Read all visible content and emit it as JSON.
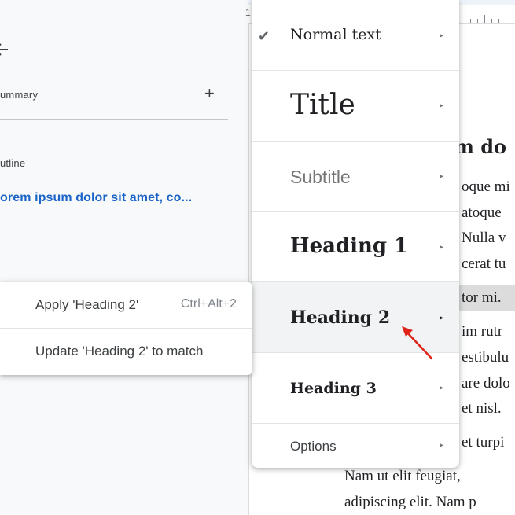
{
  "ruler": {
    "number": "1"
  },
  "outline_panel": {
    "summary_label": "ummary",
    "add_icon": "+",
    "outline_label": "utline",
    "outline_item": "orem ipsum dolor sit amet, co..."
  },
  "document": {
    "heading": "um do",
    "lines": [
      "oque mi",
      "atoque",
      "Nulla v",
      "cerat tu",
      "tor mi.",
      "im rutr",
      "estibulu",
      "are dolo",
      "et nisl.",
      "et turpi",
      "Nam ut elit feugiat,",
      "adipiscing elit. Nam p"
    ]
  },
  "styles_menu": {
    "check_icon": "✔",
    "chevron_icon": "▸",
    "items": [
      {
        "label": "Normal text"
      },
      {
        "label": "Title"
      },
      {
        "label": "Subtitle"
      },
      {
        "label": "Heading 1"
      },
      {
        "label": "Heading 2"
      },
      {
        "label": "Heading 3"
      },
      {
        "label": "Options"
      }
    ]
  },
  "submenu": {
    "apply_label": "Apply 'Heading 2'",
    "apply_shortcut": "Ctrl+Alt+2",
    "update_label": "Update 'Heading 2' to match"
  },
  "colors": {
    "accent_link": "#1a64c8",
    "annotation_arrow": "#e0231a",
    "hover_bg": "#f1f3f4"
  }
}
